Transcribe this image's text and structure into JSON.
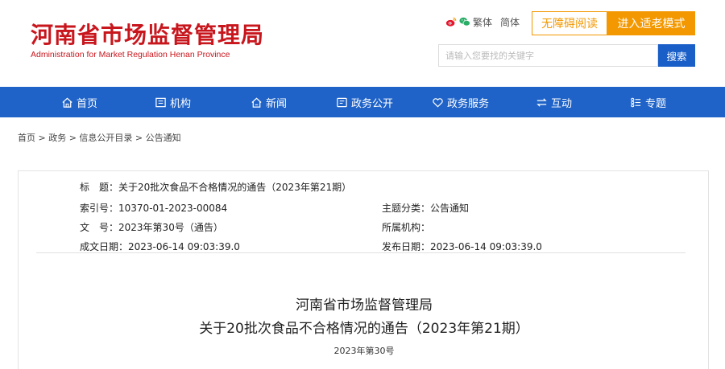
{
  "header": {
    "logo_cn": "河南省市场监督管理局",
    "logo_en": "Administration for Market Regulation Henan Province",
    "traditional_label": "繁体",
    "simplified_label": "简体",
    "accessible_label": "无障碍阅读",
    "elder_label": "进入适老模式",
    "search_placeholder": "请输入您要找的关键字",
    "search_button": "搜索",
    "accent_color": "#c8161d",
    "orange_color": "#f39800"
  },
  "nav": {
    "color": "#1f63c8",
    "items": [
      {
        "label": "首页",
        "icon": "home-icon"
      },
      {
        "label": "机构",
        "icon": "building-icon"
      },
      {
        "label": "新闻",
        "icon": "news-icon"
      },
      {
        "label": "政务公开",
        "icon": "document-icon"
      },
      {
        "label": "政务服务",
        "icon": "heart-icon"
      },
      {
        "label": "互动",
        "icon": "exchange-icon"
      },
      {
        "label": "专题",
        "icon": "list-icon"
      }
    ]
  },
  "breadcrumb": "首页 > 政务 > 信息公开目录 > 公告通知",
  "meta": {
    "title_label": "标　题：",
    "title_value": "关于20批次食品不合格情况的通告（2023年第21期）",
    "index_label": "索引号：",
    "index_value": "10370-01-2023-00084",
    "category_label": "主题分类：",
    "category_value": "公告通知",
    "docno_label": "文　号：",
    "docno_value": "2023年第30号（通告）",
    "org_label": "所属机构：",
    "org_value": "",
    "created_label": "成文日期：",
    "created_value": "2023-06-14 09:03:39.0",
    "published_label": "发布日期：",
    "published_value": "2023-06-14 09:03:39.0"
  },
  "document": {
    "heading1": "河南省市场监督管理局",
    "heading2": "关于20批次食品不合格情况的通告（2023年第21期）",
    "number": "2023年第30号"
  }
}
